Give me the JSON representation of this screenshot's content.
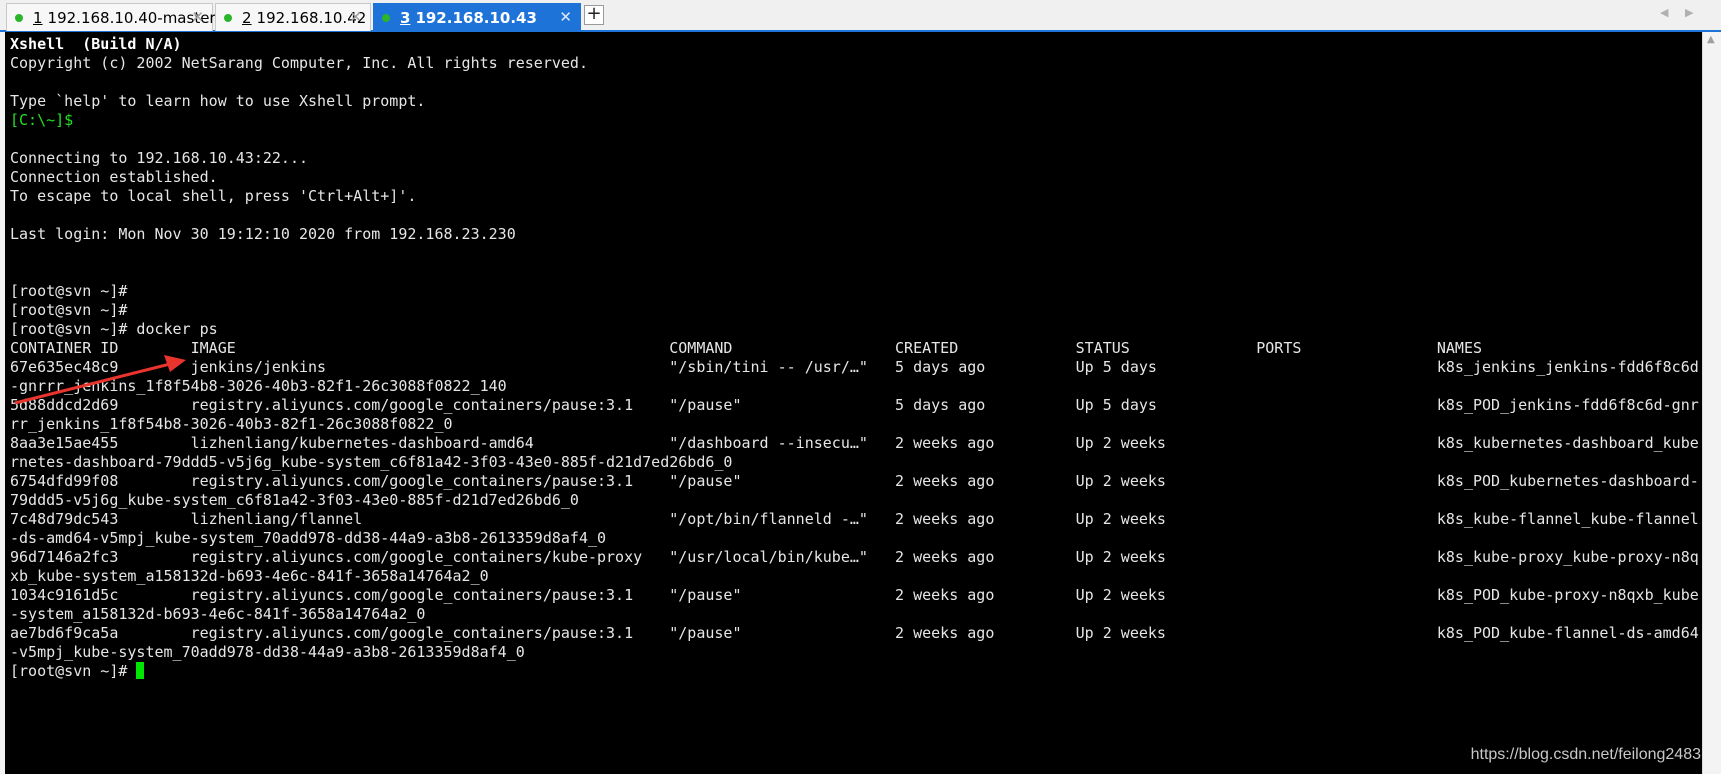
{
  "tabs": [
    {
      "num": "1",
      "title": "192.168.10.40-master",
      "active": false
    },
    {
      "num": "2",
      "title": "192.168.10.42",
      "active": false
    },
    {
      "num": "3",
      "title": "192.168.10.43",
      "active": true
    }
  ],
  "tab_close_glyph": "✕",
  "add_tab_glyph": "+",
  "terminal": {
    "lines": [
      {
        "text": "Xshell  (Build N/A)",
        "style": "bold"
      },
      {
        "text": "Copyright (c) 2002 NetSarang Computer, Inc. All rights reserved."
      },
      {
        "text": ""
      },
      {
        "text": "Type `help' to learn how to use Xshell prompt."
      },
      {
        "text": "[C:\\~]$",
        "style": "prompt-green"
      },
      {
        "text": ""
      },
      {
        "text": "Connecting to 192.168.10.43:22..."
      },
      {
        "text": "Connection established."
      },
      {
        "text": "To escape to local shell, press 'Ctrl+Alt+]'."
      },
      {
        "text": ""
      },
      {
        "text": "Last login: Mon Nov 30 19:12:10 2020 from 192.168.23.230"
      },
      {
        "text": ""
      },
      {
        "text": ""
      },
      {
        "text": "[root@svn ~]#"
      },
      {
        "text": "[root@svn ~]#"
      },
      {
        "text": "[root@svn ~]# docker ps"
      },
      {
        "text": "CONTAINER ID        IMAGE                                                COMMAND                  CREATED             STATUS              PORTS               NAMES"
      },
      {
        "text": "67e635ec48c9        jenkins/jenkins                                      \"/sbin/tini -- /usr/…\"   5 days ago          Up 5 days                               k8s_jenkins_jenkins-fdd6f8c6d"
      },
      {
        "text": "-gnrrr_jenkins_1f8f54b8-3026-40b3-82f1-26c3088f0822_140"
      },
      {
        "text": "5d88ddcd2d69        registry.aliyuncs.com/google_containers/pause:3.1    \"/pause\"                 5 days ago          Up 5 days                               k8s_POD_jenkins-fdd6f8c6d-gnr"
      },
      {
        "text": "rr_jenkins_1f8f54b8-3026-40b3-82f1-26c3088f0822_0"
      },
      {
        "text": "8aa3e15ae455        lizhenliang/kubernetes-dashboard-amd64               \"/dashboard --insecu…\"   2 weeks ago         Up 2 weeks                              k8s_kubernetes-dashboard_kube"
      },
      {
        "text": "rnetes-dashboard-79ddd5-v5j6g_kube-system_c6f81a42-3f03-43e0-885f-d21d7ed26bd6_0"
      },
      {
        "text": "6754dfd99f08        registry.aliyuncs.com/google_containers/pause:3.1    \"/pause\"                 2 weeks ago         Up 2 weeks                              k8s_POD_kubernetes-dashboard-"
      },
      {
        "text": "79ddd5-v5j6g_kube-system_c6f81a42-3f03-43e0-885f-d21d7ed26bd6_0"
      },
      {
        "text": "7c48d79dc543        lizhenliang/flannel                                  \"/opt/bin/flanneld -…\"   2 weeks ago         Up 2 weeks                              k8s_kube-flannel_kube-flannel"
      },
      {
        "text": "-ds-amd64-v5mpj_kube-system_70add978-dd38-44a9-a3b8-2613359d8af4_0"
      },
      {
        "text": "96d7146a2fc3        registry.aliyuncs.com/google_containers/kube-proxy   \"/usr/local/bin/kube…\"   2 weeks ago         Up 2 weeks                              k8s_kube-proxy_kube-proxy-n8q"
      },
      {
        "text": "xb_kube-system_a158132d-b693-4e6c-841f-3658a14764a2_0"
      },
      {
        "text": "1034c9161d5c        registry.aliyuncs.com/google_containers/pause:3.1    \"/pause\"                 2 weeks ago         Up 2 weeks                              k8s_POD_kube-proxy-n8qxb_kube"
      },
      {
        "text": "-system_a158132d-b693-4e6c-841f-3658a14764a2_0"
      },
      {
        "text": "ae7bd6f9ca5a        registry.aliyuncs.com/google_containers/pause:3.1    \"/pause\"                 2 weeks ago         Up 2 weeks                              k8s_POD_kube-flannel-ds-amd64"
      },
      {
        "text": "-v5mpj_kube-system_70add978-dd38-44a9-a3b8-2613359d8af4_0"
      }
    ],
    "final_prompt": "[root@svn ~]# ",
    "accent_prompt_color": "#23e023",
    "cursor_color": "#00e600",
    "background": "#000000",
    "foreground": "#e6e6e6"
  },
  "annotation_arrow_color": "#e8342c",
  "watermark": "https://blog.csdn.net/feilong2483"
}
